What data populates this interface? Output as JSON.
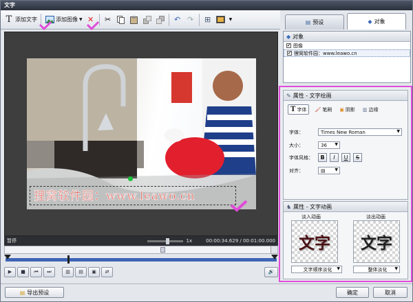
{
  "window": {
    "title": "文字"
  },
  "toolbar": {
    "add_text": "添加文字",
    "add_image": "添加图像"
  },
  "tabs": [
    {
      "label": "预设"
    },
    {
      "label": "对象"
    }
  ],
  "objects": {
    "title": "对象",
    "items": [
      {
        "label": "图像",
        "checked": true
      },
      {
        "label": "狸窝软件园：www.leawo.cn",
        "checked": true
      }
    ]
  },
  "preview": {
    "overlay_text": "狸窝软件园：www.leawo.cn",
    "status_label": "暂停",
    "speed": "1x",
    "time": "00:00:34.629 / 00:01:00.000"
  },
  "text_props": {
    "title": "属性 - 文字绘画",
    "tabs": [
      "字体",
      "笔刷",
      "阴影",
      "边缘"
    ],
    "font_label": "字体：",
    "font_value": "Times New Roman",
    "size_label": "大小：",
    "size_value": "36",
    "style_label": "字体风格：",
    "align_label": "对齐：",
    "bold": "B",
    "italic": "I",
    "underline": "U",
    "strike": "S"
  },
  "anim": {
    "title": "属性 - 文字动画",
    "fade_in_label": "淡入动画",
    "fade_out_label": "淡出动画",
    "sample_text": "文字",
    "fade_in_value": "文字顺序淡化",
    "fade_out_value": "整体淡化"
  },
  "footer": {
    "export_preset": "导出预设",
    "ok": "确定",
    "cancel": "取消"
  },
  "colors": {
    "highlight": "#e04bd8",
    "overlay_text": "#e0443a",
    "accent_green": "#19c43a"
  }
}
